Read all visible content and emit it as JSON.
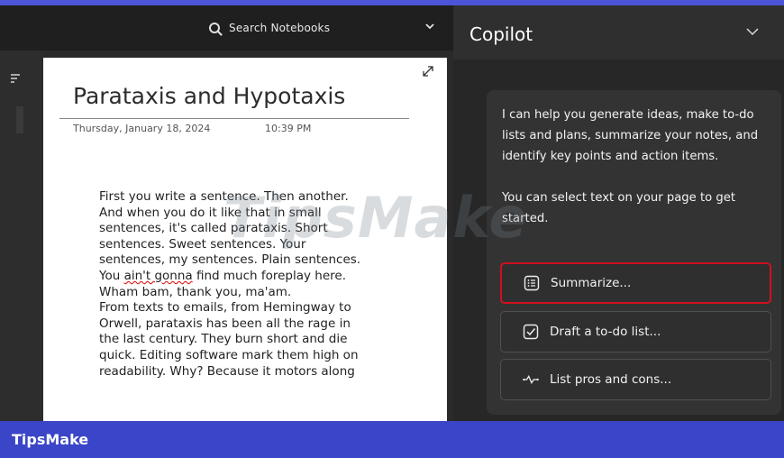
{
  "search": {
    "placeholder": "Search Notebooks"
  },
  "note": {
    "title": "Parataxis and Hypotaxis",
    "date": "Thursday, January 18, 2024",
    "time": "10:39 PM",
    "lines": [
      "First you write a sentence. Then another.",
      "And when you do it like that in small",
      "sentences, it's called parataxis. Short",
      "sentences. Sweet sentences. Your",
      "sentences, my sentences. Plain sentences.",
      "find much foreplay here.",
      "Wham bam, thank you, ma'am.",
      "From texts to emails, from Hemingway to",
      "Orwell, parataxis has been all the rage in",
      "the last century. They burn short and die",
      "quick. Editing software mark them high on",
      "readability. Why? Because it motors along"
    ],
    "line6_prefix": "You ",
    "line6_misspelled": "ain't gonna",
    "line6_rest": " find much foreplay here."
  },
  "copilot": {
    "title": "Copilot",
    "message_1": "I can help you generate ideas, make to-do lists and plans, summarize your notes, and identify key points and action items.",
    "message_2": "You can select text on your page to get started.",
    "buttons": [
      {
        "label": "Summarize...",
        "icon": "list-icon"
      },
      {
        "label": "Draft a to-do list...",
        "icon": "checkbox-icon"
      },
      {
        "label": "List pros and cons...",
        "icon": "pulse-icon"
      }
    ]
  },
  "footer": {
    "brand": "TipsMake"
  },
  "watermark": "TipsMake",
  "colors": {
    "accent_bar": "#3a45c8",
    "highlight": "#d0101d"
  }
}
